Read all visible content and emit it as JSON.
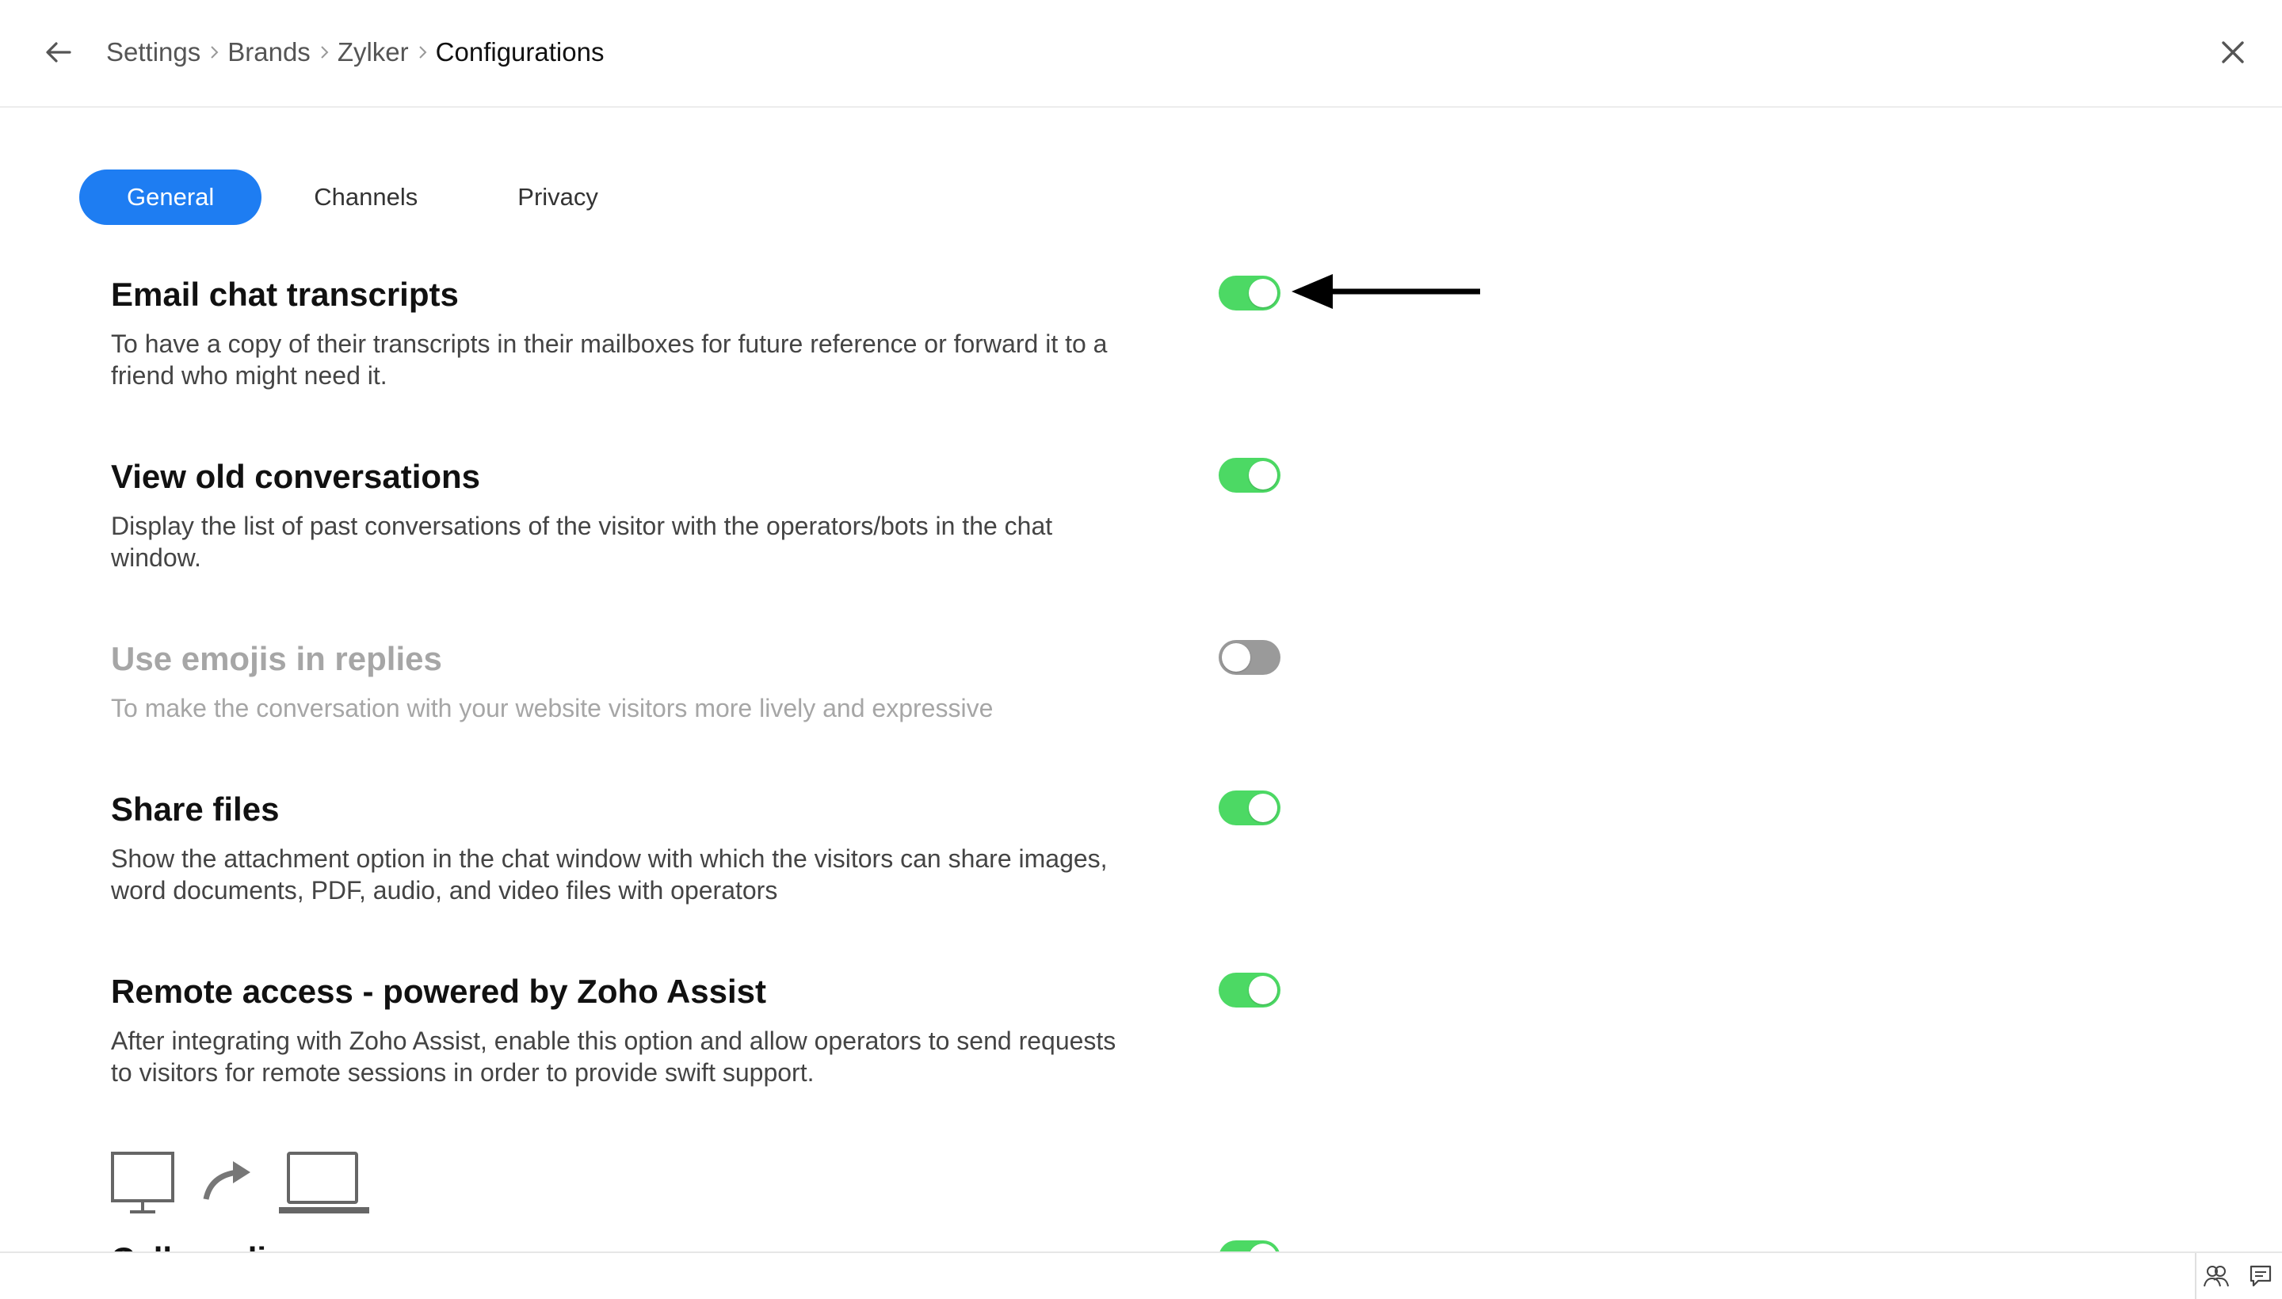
{
  "header": {
    "back_icon": "arrow-left-icon",
    "breadcrumb": [
      "Settings",
      "Brands",
      "Zylker",
      "Configurations"
    ],
    "close_icon": "close-icon"
  },
  "tabs": [
    {
      "label": "General",
      "active": true
    },
    {
      "label": "Channels",
      "active": false
    },
    {
      "label": "Privacy",
      "active": false
    }
  ],
  "settings": [
    {
      "title": "Email chat transcripts",
      "description": "To have a copy of their transcripts in their mailboxes for future reference or forward it to a friend who might need it.",
      "enabled": true
    },
    {
      "title": "View old conversations",
      "description": "Display the list of past conversations of the visitor with the operators/bots in the chat window.",
      "enabled": true
    },
    {
      "title": "Use emojis in replies",
      "description": "To make the conversation with your website visitors more lively and expressive",
      "enabled": false
    },
    {
      "title": "Share files",
      "description": "Show the attachment option in the chat window with which the visitors can share images, word documents, PDF, audio, and video files with operators",
      "enabled": true
    },
    {
      "title": "Remote access - powered by Zoho Assist",
      "description": "After integrating with Zoho Assist, enable this option and allow operators to send requests to visitors for remote sessions in order to provide swift support.",
      "enabled": true
    }
  ],
  "partial_setting": {
    "title": "Call co...li...",
    "enabled": true
  },
  "annotation": {
    "icon": "pointer-arrow-icon"
  },
  "remote_illustration": {
    "icons": [
      "monitor-icon",
      "share-arrow-icon",
      "laptop-icon"
    ]
  },
  "footer": {
    "icons": [
      "visitors-icon",
      "chat-icon"
    ]
  },
  "colors": {
    "accent": "#1e7df2",
    "toggle_on": "#4cd964",
    "toggle_off": "#9a9a9a"
  }
}
